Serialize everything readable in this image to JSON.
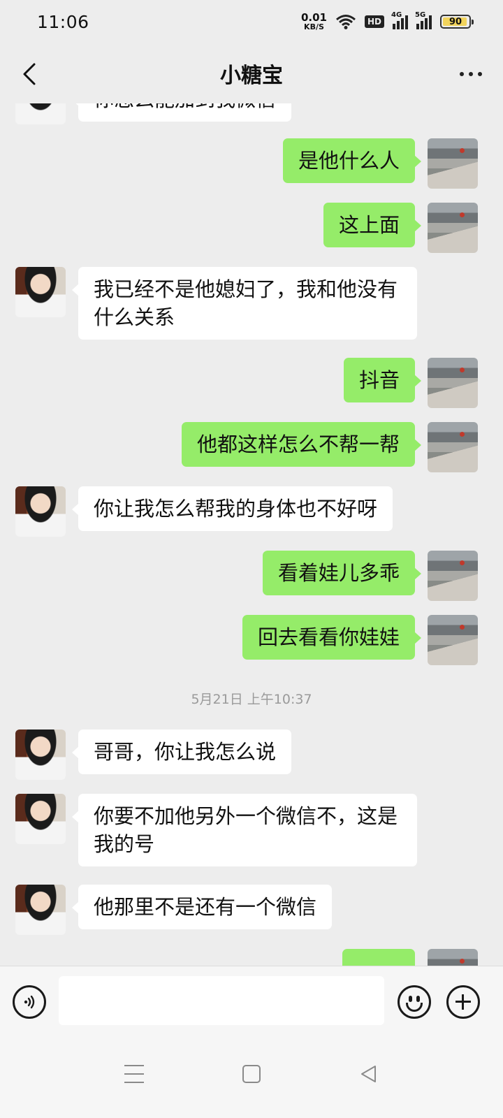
{
  "status_bar": {
    "time": "11:06",
    "net_speed_value": "0.01",
    "net_speed_unit": "KB/S",
    "hd_label": "HD",
    "sig1_label": "4G",
    "sig2_label": "5G",
    "battery": "90"
  },
  "header": {
    "title": "小糖宝"
  },
  "messages": [
    {
      "side": "other",
      "text": "你怎么能加到我微信"
    },
    {
      "side": "self",
      "text": "是他什么人"
    },
    {
      "side": "self",
      "text": "这上面"
    },
    {
      "side": "other",
      "text": "我已经不是他媳妇了，我和他没有"
    },
    {
      "side": "other",
      "text": "什么关系"
    },
    {
      "side": "self",
      "text": "抖音"
    },
    {
      "side": "self",
      "text": "他都这样怎么不帮一帮"
    },
    {
      "side": "other",
      "text": "你让我怎么帮我的身体也不好呀"
    },
    {
      "side": "self",
      "text": "看着娃儿多乖"
    },
    {
      "side": "self",
      "text": "回去看看你娃娃"
    },
    {
      "side": "other",
      "text": "哥哥，你让我怎么说"
    },
    {
      "side": "other",
      "text": "你要不加他另外一个微信不，这是"
    },
    {
      "side": "other",
      "text": "我的号"
    },
    {
      "side": "other",
      "text": "他那里不是还有一个微信"
    },
    {
      "side": "self",
      "text": ""
    }
  ],
  "timestamp": "5月21日 上午10:37",
  "input_bar": {
    "placeholder": ""
  },
  "colors": {
    "self_bubble": "#95ec69",
    "other_bubble": "#ffffff",
    "background": "#ededed"
  },
  "icons": {
    "back": "chevron-left-icon",
    "more": "more-dots-icon",
    "voice": "voice-icon",
    "emoji": "emoji-icon",
    "plus": "plus-icon"
  }
}
